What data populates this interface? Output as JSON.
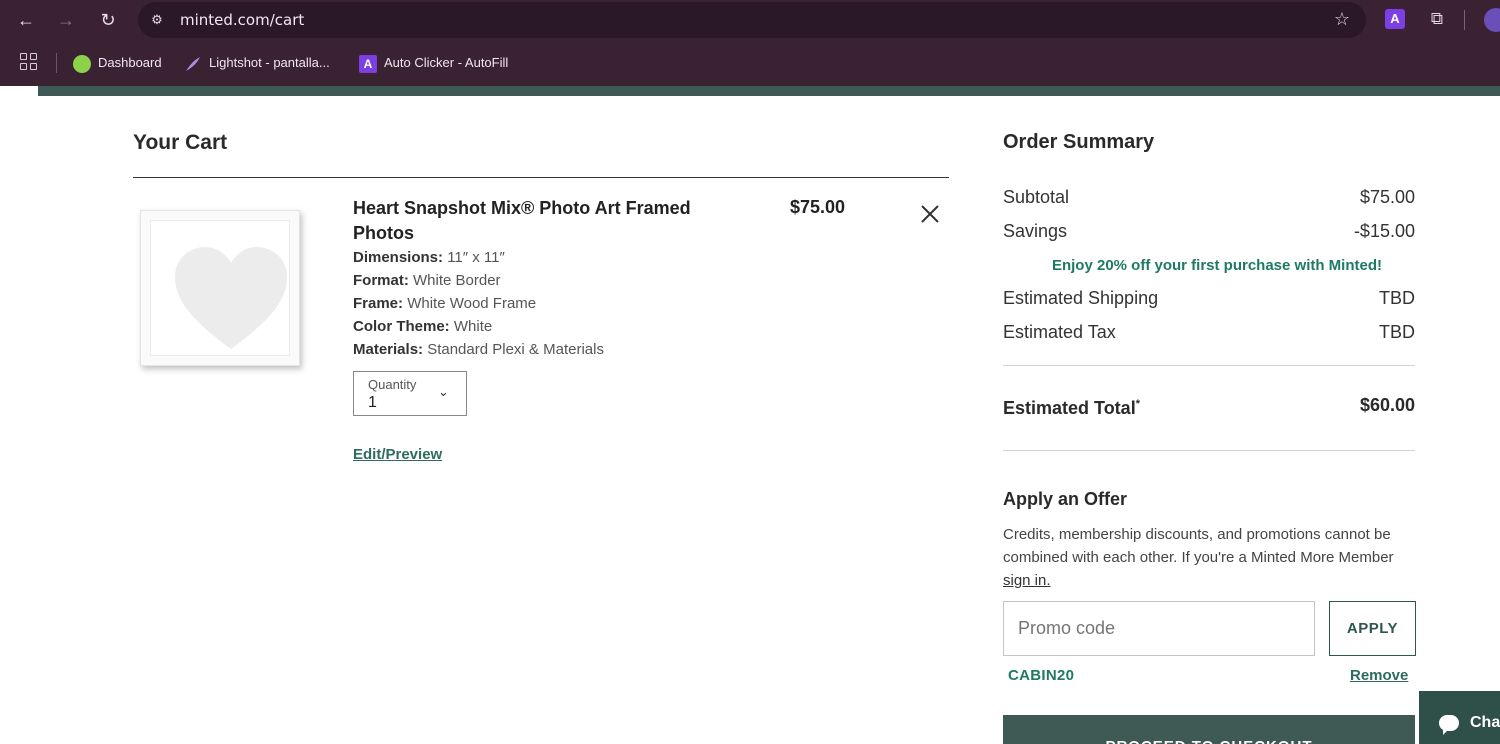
{
  "browser": {
    "url": "minted.com/cart",
    "extension_letter": "A",
    "bookmarks": [
      {
        "label": "Dashboard",
        "icon": "dashboard-icon"
      },
      {
        "label": "Lightshot - pantalla...",
        "icon": "feather-icon"
      },
      {
        "label": "Auto Clicker - AutoFill",
        "icon": "auto-clicker-icon"
      }
    ]
  },
  "cart": {
    "title": "Your Cart",
    "item": {
      "name": "Heart Snapshot Mix® Photo Art Framed Photos",
      "price": "$75.00",
      "specs": [
        {
          "label": "Dimensions:",
          "value": "11″ x 11″"
        },
        {
          "label": "Format:",
          "value": "White Border"
        },
        {
          "label": "Frame:",
          "value": "White Wood Frame"
        },
        {
          "label": "Color Theme:",
          "value": "White"
        },
        {
          "label": "Materials:",
          "value": "Standard Plexi & Materials"
        }
      ],
      "quantity_label": "Quantity",
      "quantity_value": "1",
      "edit_link": "Edit/Preview"
    }
  },
  "summary": {
    "title": "Order Summary",
    "subtotal_label": "Subtotal",
    "subtotal_value": "$75.00",
    "savings_label": "Savings",
    "savings_value": "-$15.00",
    "promo_message": "Enjoy 20% off your first purchase with Minted!",
    "shipping_label": "Estimated Shipping",
    "shipping_value": "TBD",
    "tax_label": "Estimated Tax",
    "tax_value": "TBD",
    "total_label": "Estimated Total",
    "total_marker": "*",
    "total_value": "$60.00"
  },
  "offer": {
    "title": "Apply an Offer",
    "text": "Credits, membership discounts, and promotions cannot be combined with each other. If you're a Minted More Member",
    "sign_in": "sign in.",
    "input_placeholder": "Promo code",
    "apply_label": "APPLY",
    "applied_code": "CABIN20",
    "remove_label": "Remove"
  },
  "checkout_label": "PROCEED TO CHECKOUT",
  "chat_label": "Cha",
  "colors": {
    "brand_green": "#3f5a54",
    "promo_green": "#1f7a64",
    "browser_chrome": "#3a2233"
  }
}
